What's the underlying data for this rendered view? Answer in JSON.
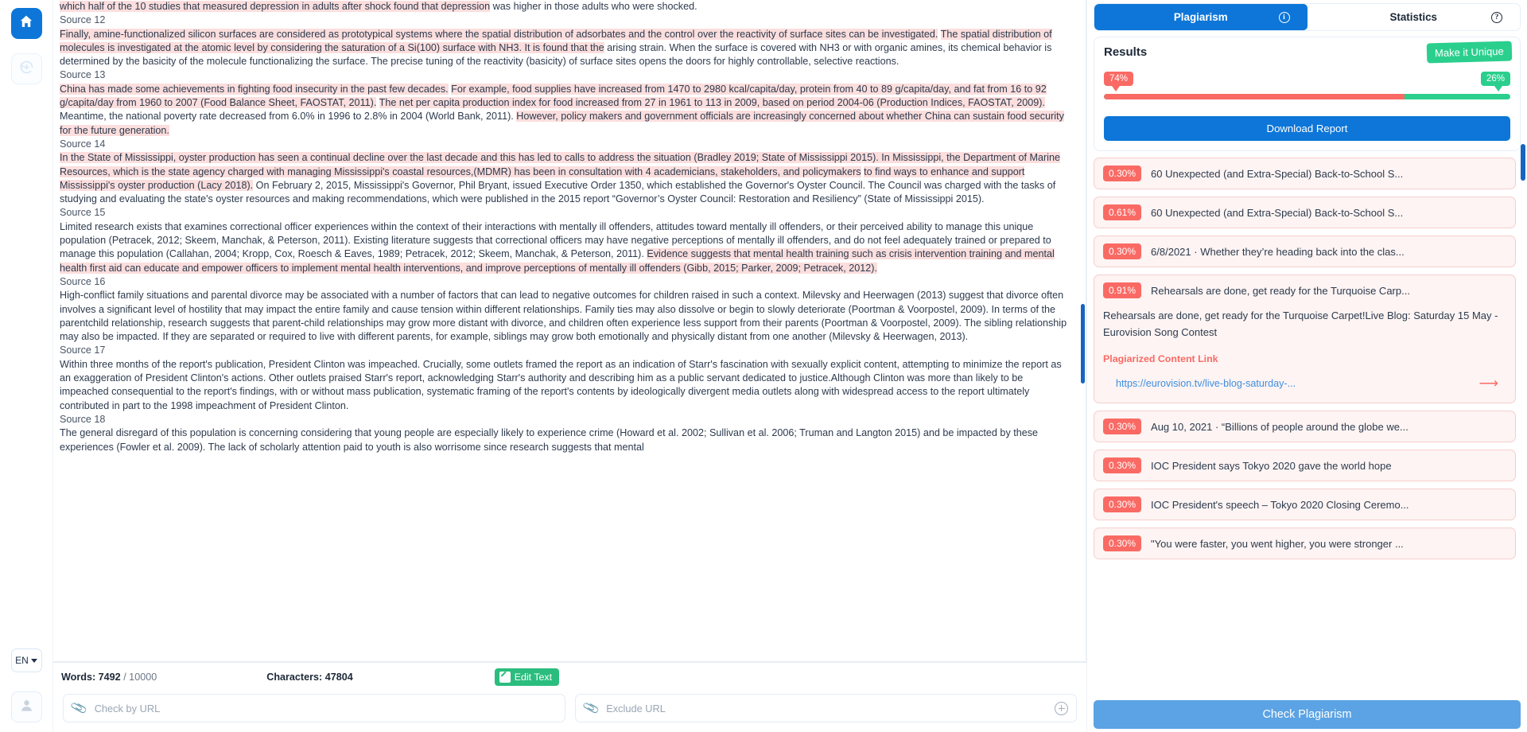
{
  "rail": {
    "home_icon": "home-icon",
    "history_icon": "restore-history-icon",
    "language": "EN",
    "user_icon": "user-avatar-icon"
  },
  "document": {
    "blocks": [
      {
        "type": "text",
        "runs": [
          {
            "t": "which half of the 10 studies that measured depression in adults after shock found that depression",
            "h": true
          },
          {
            "t": " was higher in those adults who were shocked.",
            "h": false
          }
        ]
      },
      {
        "type": "source",
        "label": "Source 12"
      },
      {
        "type": "text",
        "runs": [
          {
            "t": "Finally, amine-functionalized silicon surfaces are considered as prototypical systems where the spatial distribution of adsorbates and the control over the reactivity of surface sites can be investigated.",
            "h": true
          },
          {
            "t": " ",
            "h": false
          },
          {
            "t": "The spatial distribution of molecules is investigated at the atomic level by considering the saturation of a Si(100) surface with NH3. It is found that the",
            "h": true
          },
          {
            "t": " arising strain. When the surface is covered with NH3 or with organic amines, its chemical behavior is determined by the basicity of the molecule functionalizing the surface. The precise tuning of the reactivity (basicity) of surface sites opens the doors for highly controllable, selective reactions.",
            "h": false
          }
        ]
      },
      {
        "type": "source",
        "label": "Source 13"
      },
      {
        "type": "text",
        "runs": [
          {
            "t": "China has made some achievements in fighting food insecurity in the past few decades.",
            "h": true
          },
          {
            "t": " ",
            "h": false
          },
          {
            "t": "For example, food supplies have increased from 1470 to 2980 kcal/capita/day, protein from 40 to 89 g/capita/day, and fat from 16 to 92 g/capita/day from 1960 to 2007 (Food Balance Sheet, FAOSTAT, 2011).",
            "h": true
          },
          {
            "t": " ",
            "h": false
          },
          {
            "t": "The net per capita production index for food increased from 27 in 1961 to 113 in 2009, based on period 2004-06 (Production Indices, FAOSTAT, 2009).",
            "h": true
          },
          {
            "t": " Meantime, the national poverty rate decreased from 6.0% in 1996 to 2.8% in 2004 (World Bank, 2011). ",
            "h": false
          },
          {
            "t": "However, policy makers and government officials are increasingly concerned about whether China can sustain food security for the future generation.",
            "h": true
          }
        ]
      },
      {
        "type": "source",
        "label": "Source 14"
      },
      {
        "type": "text",
        "runs": [
          {
            "t": "In the State of Mississippi, oyster production has seen a continual decline over the last decade and this has led to calls to address the situation (Bradley 2019; State of Mississippi 2015). In Mississippi, the Department of Marine Resources, which is the state agency charged with managing Mississippi's coastal resources,(MDMR) has been in consultation with 4 academicians, stakeholders, and policymakers",
            "h": true
          },
          {
            "t": " ",
            "h": false
          },
          {
            "t": "to find ways to enhance and support Mississippi's oyster production (Lacy 2018).",
            "h": true
          },
          {
            "t": " On February 2, 2015, Mississippi's Governor, Phil Bryant, issued Executive Order 1350, which established the Governor's Oyster Council. The Council was charged with the tasks of studying and evaluating the state's oyster resources and making recommendations, which were published in the 2015 report “Governor’s Oyster Council: Restoration and Resiliency” (State of Mississippi 2015).",
            "h": false
          }
        ]
      },
      {
        "type": "source",
        "label": "Source 15"
      },
      {
        "type": "text",
        "runs": [
          {
            "t": "Limited research exists that examines correctional officer experiences within the context of their interactions with mentally ill offenders, attitudes toward mentally ill offenders, or their perceived ability to manage this unique population (Petracek, 2012; Skeem, Manchak, & Peterson, 2011). Existing literature suggests that correctional officers may have negative perceptions of mentally ill offenders, and do not feel adequately trained or prepared to manage this population (Callahan, 2004; Kropp, Cox, Roesch & Eaves, 1989; Petracek, 2012; Skeem, Manchak, & Peterson, 2011). ",
            "h": false
          },
          {
            "t": "Evidence suggests that mental health training such as crisis intervention training and mental health first aid can educate and empower officers to implement mental health interventions, and improve perceptions of mentally ill offenders (Gibb, 2015; Parker, 2009; Petracek, 2012).",
            "h": true
          }
        ]
      },
      {
        "type": "source",
        "label": "Source 16"
      },
      {
        "type": "text",
        "runs": [
          {
            "t": "High-conflict family situations and parental divorce may be associated with a number of factors that can lead to negative outcomes for children raised in such a context. Milevsky and Heerwagen (2013) suggest that divorce often involves a significant level of hostility that may impact the entire family and cause tension within different relationships. Family ties may also dissolve or begin to slowly deteriorate (Poortman & Voorpostel, 2009). In terms of the parentchild relationship, research suggests that parent-child relationships may grow more distant with divorce, and children often experience less support from their parents (Poortman & Voorpostel, 2009). The sibling relationship may also be impacted. If they are separated or required to live with different parents, for example, siblings may grow both emotionally and physically distant from one another (Milevsky & Heerwagen, 2013).",
            "h": false
          }
        ]
      },
      {
        "type": "source",
        "label": "Source 17"
      },
      {
        "type": "text",
        "runs": [
          {
            "t": "Within three months of the report's publication, President Clinton was impeached. Crucially, some outlets framed the report as an indication of Starr's fascination with sexually explicit content, attempting to minimize the report as an exaggeration of President Clinton's actions. Other outlets praised Starr's report, acknowledging Starr's authority and describing him as a public servant dedicated to justice.Although Clinton was more than likely to be impeached consequential to the report's findings, with or without mass publication, systematic framing of the report's contents by ideologically divergent media outlets along with widespread access to the report ultimately contributed in part to the 1998 impeachment of President Clinton.",
            "h": false
          }
        ]
      },
      {
        "type": "source",
        "label": "Source 18"
      },
      {
        "type": "text",
        "runs": [
          {
            "t": "The general disregard of this population is concerning considering that young people are especially likely to experience crime (Howard et al. 2002; Sullivan et al. 2006; Truman and Langton 2015) and be impacted by these experiences (Fowler et al. 2009). The lack of scholarly attention paid to youth is also worrisome since research suggests that mental",
            "h": false
          }
        ]
      }
    ]
  },
  "statusbar": {
    "words_label": "Words:",
    "words_count": "7492",
    "words_limit": "/ 10000",
    "characters": "Characters: 47804",
    "edit_text": "Edit Text"
  },
  "urlbar": {
    "check_placeholder": "Check by URL",
    "exclude_placeholder": "Exclude URL",
    "check_value": "",
    "exclude_value": "",
    "clip_icon": "paperclip-icon",
    "add_icon": "add-circle-icon"
  },
  "panel": {
    "tabs": [
      {
        "label": "Plagiarism",
        "active": true,
        "icon": "info-circle-icon",
        "icon_glyph": "i"
      },
      {
        "label": "Statistics",
        "active": false,
        "icon": "question-circle-icon",
        "icon_glyph": "?"
      }
    ],
    "results": {
      "title": "Results",
      "make_unique": "Make it Unique",
      "plagiarized_pct": "74%",
      "unique_pct": "26%",
      "plagiarized_value": 74,
      "unique_value": 26,
      "plagiarized_color": "#fa6a64",
      "unique_color": "#2bcf8d",
      "download_label": "Download Report"
    },
    "sources": [
      {
        "pct": "0.30%",
        "title": "60 Unexpected (and Extra-Special) Back-to-School S...",
        "expanded": false
      },
      {
        "pct": "0.61%",
        "title": "60 Unexpected (and Extra-Special) Back-to-School S...",
        "expanded": false
      },
      {
        "pct": "0.30%",
        "title": "6/8/2021 · Whether they’re heading back into the clas...",
        "expanded": false
      },
      {
        "pct": "0.91%",
        "title": "Rehearsals are done, get ready for the Turquoise Carp...",
        "expanded": true,
        "snippet": "Rehearsals are done, get ready for the Turquoise Carpet!Live Blog: Saturday 15 May - Eurovision Song Contest",
        "link_label": "Plagiarized Content Link",
        "link": "https://eurovision.tv/live-blog-saturday-...",
        "arrow_icon": "arrow-right-icon"
      },
      {
        "pct": "0.30%",
        "title": "Aug 10, 2021 · “Billions of people around the globe we...",
        "expanded": false
      },
      {
        "pct": "0.30%",
        "title": "IOC President says Tokyo 2020 gave the world hope",
        "expanded": false
      },
      {
        "pct": "0.30%",
        "title": "IOC President's speech – Tokyo 2020 Closing Ceremo...",
        "expanded": false
      },
      {
        "pct": "0.30%",
        "title": "\"You were faster, you went higher, you were stronger ...",
        "expanded": false
      }
    ],
    "check_button": "Check Plagiarism"
  }
}
